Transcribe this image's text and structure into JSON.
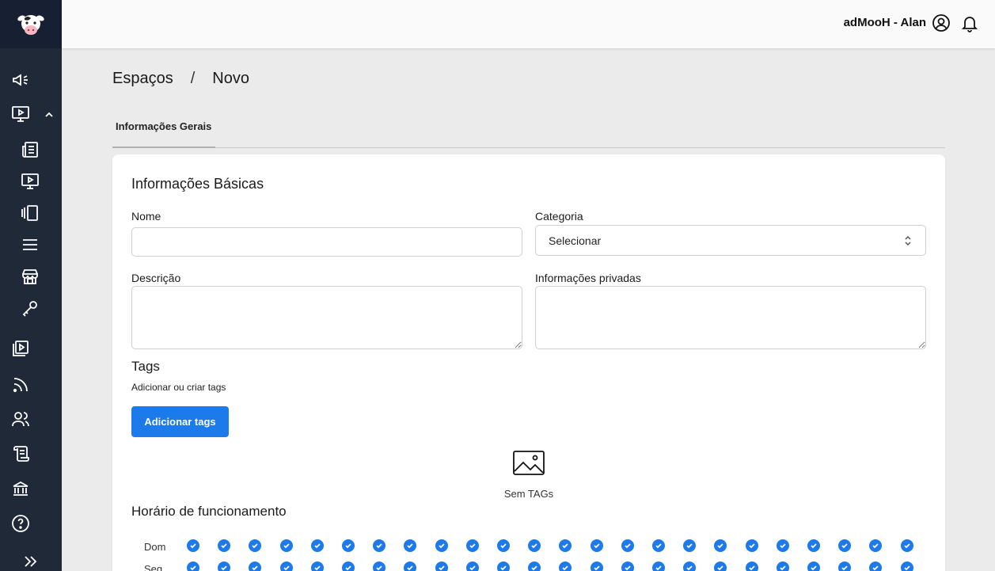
{
  "header": {
    "user_name": "adMooH - Alan"
  },
  "breadcrumb": {
    "items": [
      "Espaços",
      "Novo"
    ],
    "separator": "/"
  },
  "tabs": [
    {
      "label": "Informações Gerais",
      "active": true
    }
  ],
  "form": {
    "section_title": "Informações Básicas",
    "name_label": "Nome",
    "name_value": "",
    "category_label": "Categoria",
    "category_value": "Selecionar",
    "description_label": "Descrição",
    "description_value": "",
    "private_info_label": "Informações privadas",
    "private_info_value": ""
  },
  "tags": {
    "title": "Tags",
    "subtitle": "Adicionar ou criar tags",
    "add_button": "Adicionar tags",
    "empty_text": "Sem TAGs",
    "empty_icon": "image-icon"
  },
  "hours": {
    "title": "Horário de funcionamento",
    "days": [
      {
        "label": "Dom",
        "slots": [
          true,
          true,
          true,
          true,
          true,
          true,
          true,
          true,
          true,
          true,
          true,
          true,
          true,
          true,
          true,
          true,
          true,
          true,
          true,
          true,
          true,
          true,
          true,
          true
        ]
      },
      {
        "label": "Seg",
        "slots": [
          true,
          true,
          true,
          true,
          true,
          true,
          true,
          true,
          true,
          true,
          true,
          true,
          true,
          true,
          true,
          true,
          true,
          true,
          true,
          true,
          true,
          true,
          true,
          true
        ]
      }
    ]
  },
  "sidebar": {
    "items": [
      {
        "name": "megaphone-icon"
      },
      {
        "name": "monitor-play-icon",
        "expanded": true
      },
      {
        "name": "newspaper-icon"
      },
      {
        "name": "screen-play-icon"
      },
      {
        "name": "carousel-icon"
      },
      {
        "name": "menu-lines-icon"
      },
      {
        "name": "store-icon"
      },
      {
        "name": "key-icon"
      },
      {
        "name": "playlist-icon"
      },
      {
        "name": "rss-icon"
      },
      {
        "name": "users-icon"
      },
      {
        "name": "scroll-icon"
      },
      {
        "name": "bank-icon"
      },
      {
        "name": "help-icon"
      },
      {
        "name": "expand-icon"
      }
    ]
  },
  "colors": {
    "sidebar": "#1f2937",
    "accent": "#1d7aea",
    "background": "#ebebeb"
  }
}
